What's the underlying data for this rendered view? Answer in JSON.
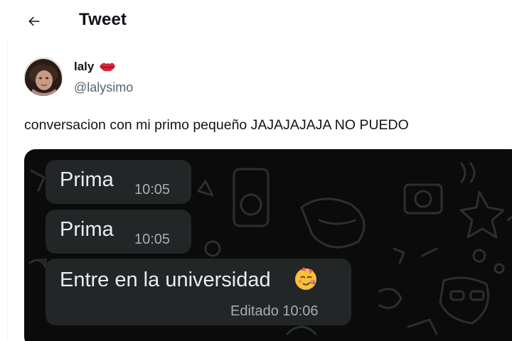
{
  "header": {
    "title": "Tweet",
    "back_icon": "arrow-left-icon"
  },
  "author": {
    "name": "laly",
    "name_emoji": "kiss-mark-icon",
    "handle": "@lalysimo"
  },
  "tweet": {
    "text": "conversacion con mi primo pequeño JAJAJAJAJA NO PUEDO"
  },
  "media": {
    "messages": [
      {
        "text": "Prima",
        "time": "10:05"
      },
      {
        "text": "Prima",
        "time": "10:05"
      },
      {
        "text": "Entre en la universidad",
        "emoji": "smiling-face-with-hearts-icon",
        "time": "Editado 10:06"
      }
    ]
  },
  "colors": {
    "accent_red": "#e0245e",
    "bubble": "#232626",
    "chat_bg": "#0b0b0b",
    "meta_text": "#a4adb2",
    "handle_text": "#536471"
  }
}
